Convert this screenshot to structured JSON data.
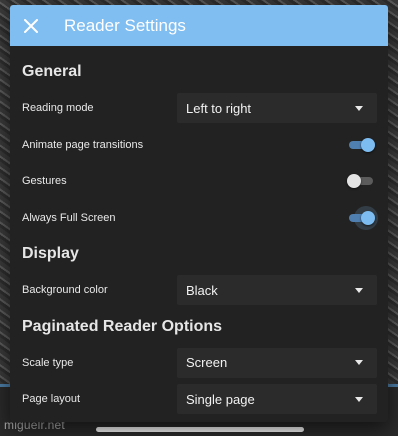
{
  "dialog": {
    "title": "Reader Settings",
    "close_icon": "close-icon"
  },
  "sections": {
    "general": {
      "header": "General",
      "reading_mode": {
        "label": "Reading mode",
        "value": "Left to right"
      },
      "animate_transitions": {
        "label": "Animate page transitions",
        "enabled": true
      },
      "gestures": {
        "label": "Gestures",
        "enabled": false
      },
      "always_full_screen": {
        "label": "Always Full Screen",
        "enabled": true
      }
    },
    "display": {
      "header": "Display",
      "background_color": {
        "label": "Background color",
        "value": "Black"
      }
    },
    "paginated": {
      "header": "Paginated Reader Options",
      "scale_type": {
        "label": "Scale type",
        "value": "Screen"
      },
      "page_layout": {
        "label": "Page layout",
        "value": "Single page"
      }
    }
  },
  "watermark": "miguelr.net",
  "colors": {
    "accent": "#80bdf0",
    "dialog_bg": "#222222",
    "switch_on": "#7dbcf0"
  }
}
